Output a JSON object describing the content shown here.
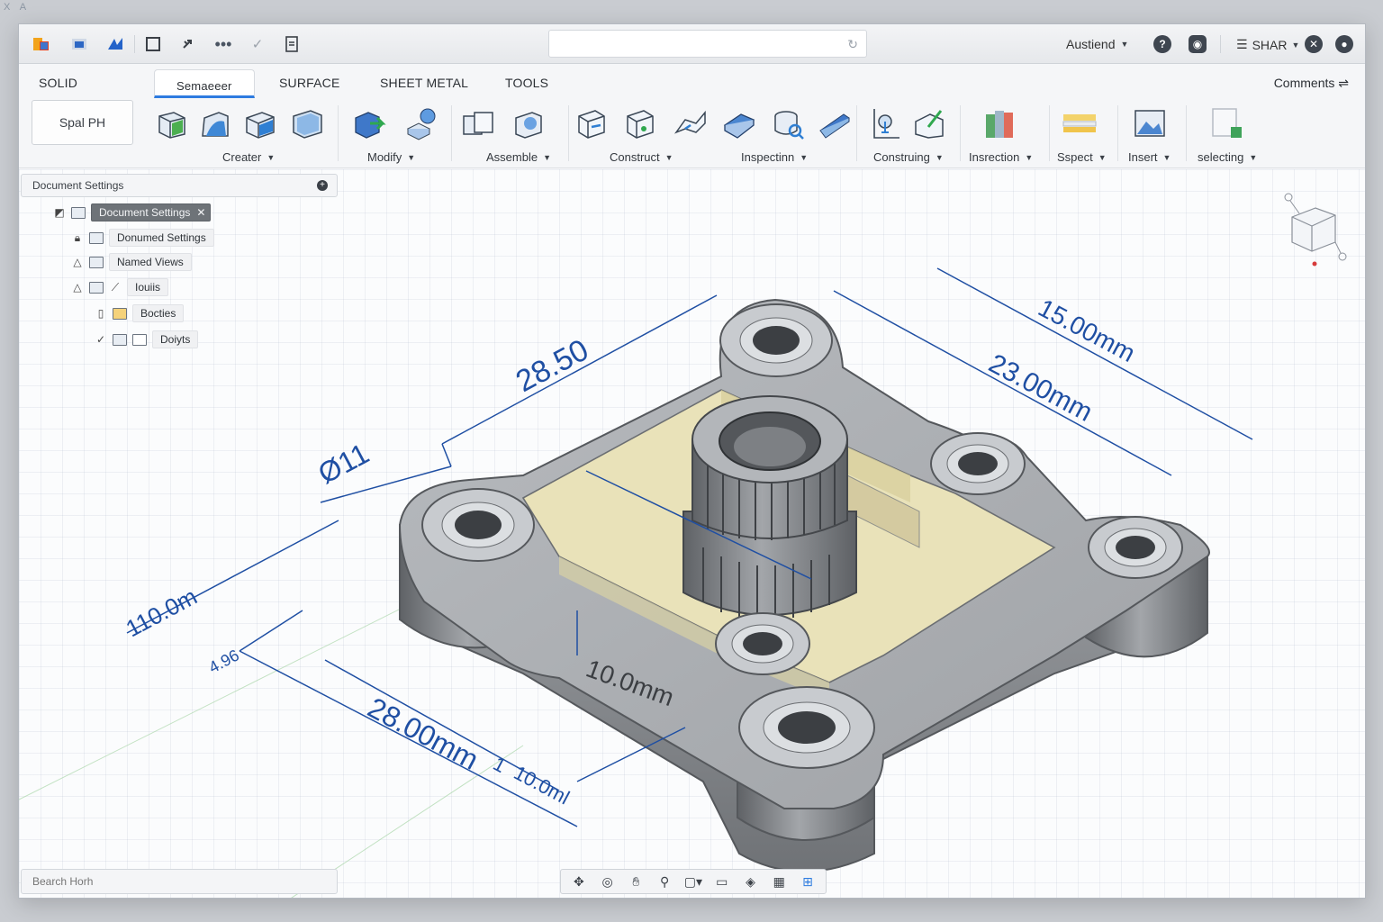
{
  "desktop": {
    "corner_text": "X A"
  },
  "toolbar": {
    "search_placeholder": "",
    "user_name": "Austiend",
    "share_label": "SHAR"
  },
  "ribbon": {
    "tabs": {
      "solid": "SOLID",
      "sketch": "Semaeeer",
      "surface": "SURFACE",
      "sheet_metal": "SHEET METAL",
      "tools": "TOOLS"
    },
    "comments_label": "Comments",
    "mode_button": "Spal PH",
    "groups": {
      "create": "Creater",
      "modify": "Modify",
      "assemble": "Assemble",
      "construct": "Construct",
      "inspect": "Inspectinn",
      "construing": "Construing",
      "insrection": "Insrection",
      "sspect": "Sspect",
      "insert": "Insert",
      "selecting": "selecting"
    }
  },
  "browser": {
    "header": "Document Settings",
    "nodes": {
      "root": "Document Settings",
      "settings": "Donumed Settings",
      "named_views": "Named Views",
      "origin": "Iouiis",
      "bodies": "Bocties",
      "joints": "Doiyts"
    }
  },
  "bottom": {
    "search_placeholder": "Bearch Horh"
  },
  "dimensions": {
    "d1": "28.50",
    "d2": "15.00mm",
    "d3": "23.00mm",
    "d4": "Ø11",
    "d5": "110.0m",
    "d6": "4.96",
    "d7": "28.00mm",
    "d8": "10.0mm",
    "d9": "1",
    "d10": "10.0ml"
  },
  "colors": {
    "accent": "#2d7be0",
    "dimension": "#1f4fa3",
    "part": "#8f9296",
    "cavity": "#e9e2b9"
  }
}
